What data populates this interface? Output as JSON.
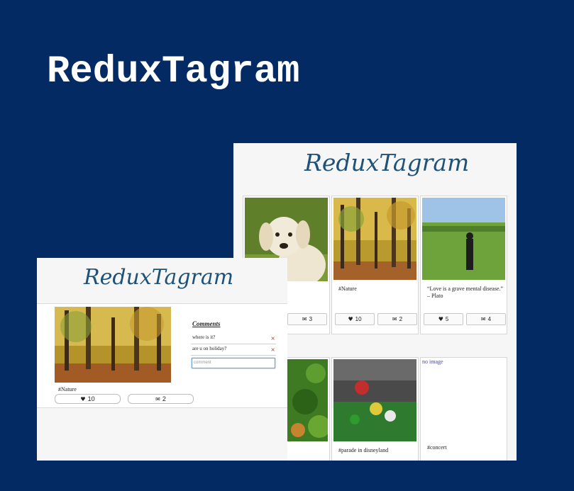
{
  "hero": {
    "title": "ReduxTagram"
  },
  "grid_screen": {
    "logo": "ReduxTagram",
    "cards": [
      {
        "caption": "",
        "likes": "",
        "comments": "3"
      },
      {
        "caption": "#Nature",
        "likes": "10",
        "comments": "2"
      },
      {
        "caption": "“Love is a grave mental disease.” – Plato",
        "likes": "5",
        "comments": "4"
      },
      {
        "caption": "",
        "likes": "",
        "comments": ""
      },
      {
        "caption": "#parade in disneyland",
        "likes": "",
        "comments": ""
      },
      {
        "caption": "#concert",
        "likes": "",
        "comments": "",
        "broken_alt": "no image"
      }
    ],
    "icons": {
      "like": "heart-icon",
      "comment": "speech-bubble-icon"
    }
  },
  "detail_screen": {
    "logo": "ReduxTagram",
    "caption": "#Nature",
    "likes": "10",
    "comments_count": "2",
    "comments_title": "Comments",
    "comments": [
      {
        "text": "where is it?"
      },
      {
        "text": "are u on holiday?"
      }
    ],
    "comment_input": {
      "placeholder": "comment"
    }
  },
  "colors": {
    "background": "#032a63",
    "logo": "#1f5279",
    "delete": "#d03030"
  }
}
